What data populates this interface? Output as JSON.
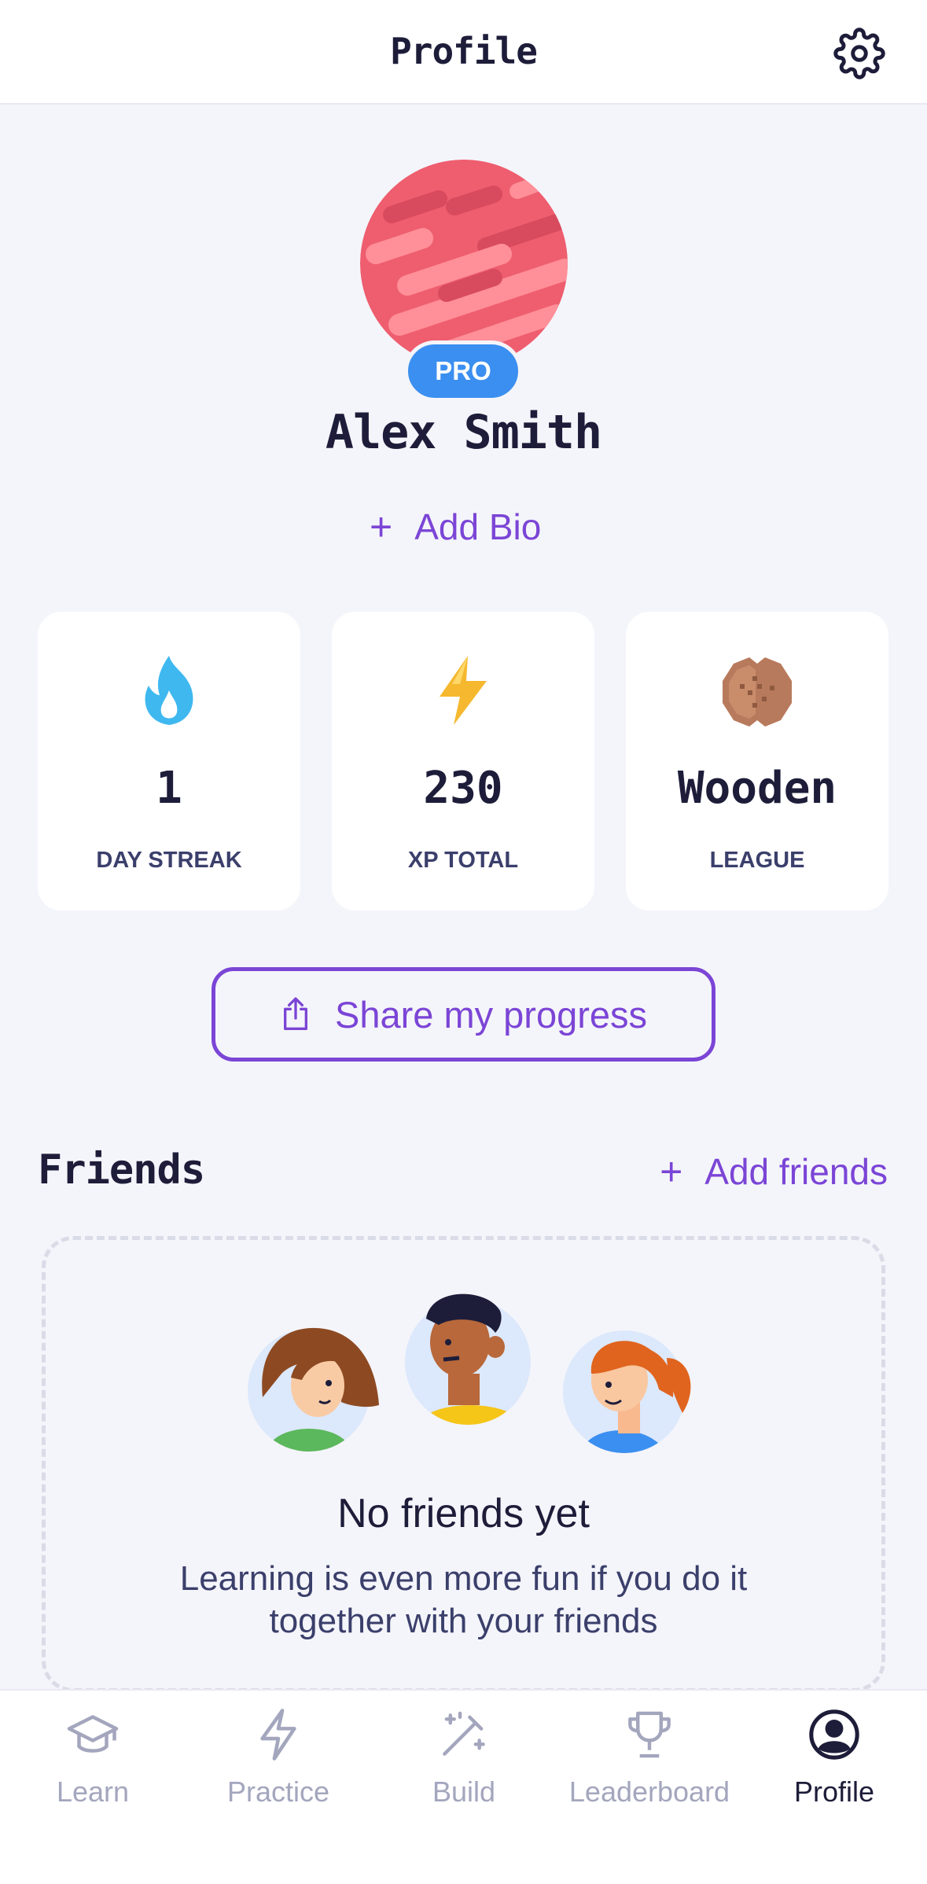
{
  "header": {
    "title": "Profile",
    "settings_icon": "gear-icon"
  },
  "profile": {
    "name": "Alex Smith",
    "badge": "PRO",
    "add_bio_label": "Add Bio"
  },
  "stats": [
    {
      "icon": "flame-icon",
      "value": "1",
      "label": "DAY STREAK"
    },
    {
      "icon": "lightning-icon",
      "value": "230",
      "label": "XP TOTAL"
    },
    {
      "icon": "wooden-league-icon",
      "value": "Wooden",
      "label": "LEAGUE"
    }
  ],
  "share": {
    "label": "Share my progress",
    "icon": "share-icon"
  },
  "friends": {
    "title": "Friends",
    "add_label": "Add friends",
    "empty_title": "No friends yet",
    "empty_subtitle": "Learning is even more fun if you do it together with your friends"
  },
  "nav": {
    "items": [
      {
        "label": "Learn",
        "icon": "graduation-cap-icon",
        "active": false
      },
      {
        "label": "Practice",
        "icon": "lightning-icon",
        "active": false
      },
      {
        "label": "Build",
        "icon": "magic-wand-icon",
        "active": false
      },
      {
        "label": "Leaderboard",
        "icon": "trophy-icon",
        "active": false
      },
      {
        "label": "Profile",
        "icon": "user-circle-icon",
        "active": true
      }
    ]
  },
  "colors": {
    "accent": "#7b45d6",
    "pro_badge": "#3b8ff0",
    "background": "#f4f5fa",
    "text_dark": "#1d1d3a",
    "inactive": "#a3a6bd"
  }
}
